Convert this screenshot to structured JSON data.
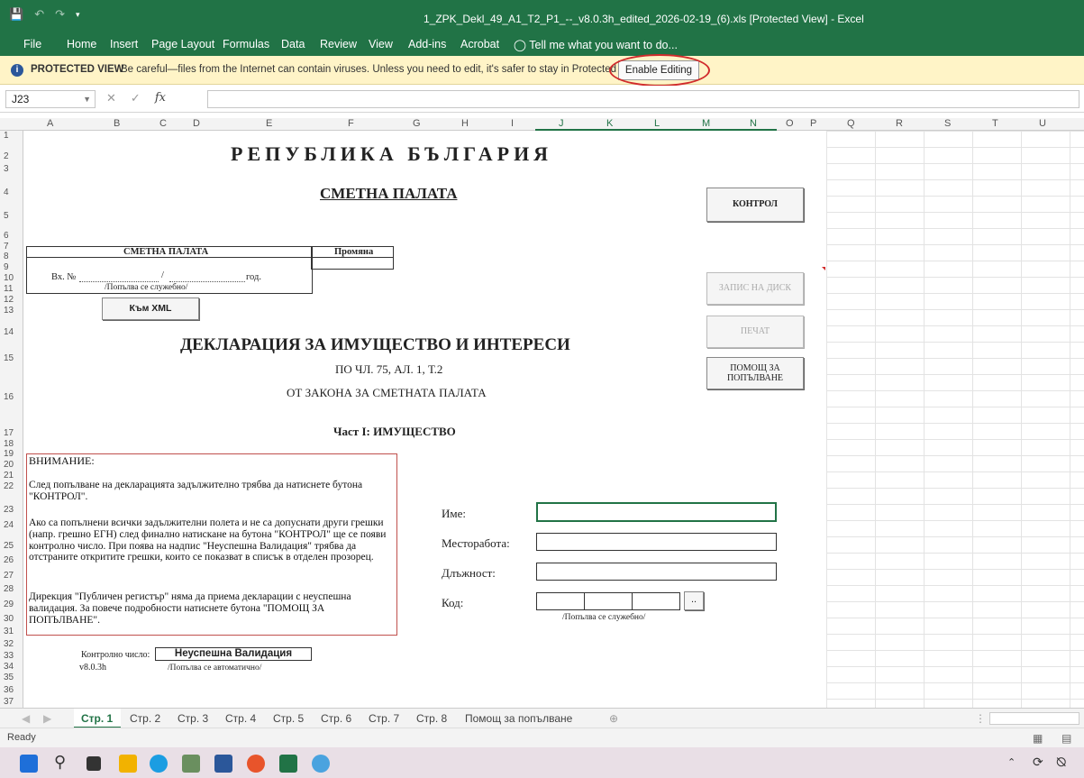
{
  "window": {
    "title": "1_ZPK_Dekl_49_A1_T2_P1_--_v8.0.3h_edited_2026-02-19_(6).xls  [Protected View]  -  Excel"
  },
  "ribbon_tabs": [
    "File",
    "Home",
    "Insert",
    "Page Layout",
    "Formulas",
    "Data",
    "Review",
    "View",
    "Add-ins",
    "Acrobat",
    "Tell me what you want to do..."
  ],
  "protected_view": {
    "label": "PROTECTED VIEW",
    "message": "Be careful—files from the Internet can contain viruses. Unless you need to edit, it's safer to stay in Protected View.",
    "enable_button": "Enable Editing"
  },
  "formula_bar": {
    "name_box": "J23",
    "fx": "fx",
    "value": ""
  },
  "columns": [
    "A",
    "B",
    "C",
    "D",
    "E",
    "F",
    "G",
    "H",
    "I",
    "J",
    "K",
    "L",
    "M",
    "N",
    "O",
    "P",
    "Q",
    "R",
    "S",
    "T",
    "U"
  ],
  "rows": [
    "1",
    "2",
    "3",
    "4",
    "5",
    "6",
    "7",
    "8",
    "9",
    "10",
    "11",
    "12",
    "13",
    "14",
    "15",
    "16",
    "17",
    "18",
    "19",
    "20",
    "21",
    "22",
    "23",
    "24",
    "25",
    "26",
    "27",
    "28",
    "29",
    "30",
    "31",
    "32",
    "33",
    "34",
    "35",
    "36",
    "37"
  ],
  "sheet": {
    "republic": "РЕПУБЛИКА БЪЛГАРИЯ",
    "chamber": "СМЕТНА ПАЛАТА",
    "box_header": "СМЕТНА ПАЛАТА",
    "change_header": "Промяна",
    "incoming_no": "Вх. №",
    "slash": "/",
    "year": "год.",
    "filled_by_office": "/Попълва се служебно/",
    "xml_button": "Към XML",
    "control_button": "КОНТРОЛ",
    "save_button": "ЗАПИС НА ДИСК",
    "print_button": "ПЕЧАТ",
    "help_button_line1": "ПОМОЩ ЗА",
    "help_button_line2": "ПОПЪЛВАНЕ",
    "declaration_title": "ДЕКЛАРАЦИЯ ЗА ИМУЩЕСТВО И ИНТЕРЕСИ",
    "article": "ПО ЧЛ. 75, АЛ. 1, Т.2",
    "law": "ОТ ЗАКОНА ЗА СМЕТНАТА ПАЛАТА",
    "part": "Част I: ИМУЩЕСТВО",
    "warning_title": "ВНИМАНИЕ:",
    "warning_p1": "След попълване на декларацията задължително трябва да натиснете бутона \"КОНТРОЛ\".",
    "warning_p2": "Ако са попълнени всички задължителни полета и не са допуснати други грешки (напр. грешно ЕГН) след финално натискане на бутона \"КОНТРОЛ\" ще се появи контролно число. При поява на надпис \"Неуспешна Валидация\" трябва да отстраните откритите грешки, които се показват в списък в отделен прозорец.",
    "warning_p3": "Дирекция \"Публичен регистър\" няма да приема декларации с неуспешна валидация. За повече подробности натиснете бутона \"ПОМОЩ ЗА ПОПЪЛВАНЕ\".",
    "name_label": "Име:",
    "workplace_label": "Месторабота:",
    "position_label": "Длъжност:",
    "code_label": "Код:",
    "code_button": "..",
    "code_note": "/Попълва се служебно/",
    "control_number_label": "Контролно число:",
    "control_number_value": "Неуспешна Валидация",
    "version": "v8.0.3h",
    "auto_filled": "/Попълва се автоматично/"
  },
  "sheet_tabs": [
    "Стр. 1",
    "Стр. 2",
    "Стр. 3",
    "Стр. 4",
    "Стр. 5",
    "Стр. 6",
    "Стр. 7",
    "Стр. 8",
    "Помощ за попълване"
  ],
  "active_sheet_tab": "Стр. 1",
  "status": "Ready",
  "colors": {
    "excel_green": "#217346",
    "protected_bar": "#fff4c7",
    "highlight_ring": "#d12c2c"
  }
}
